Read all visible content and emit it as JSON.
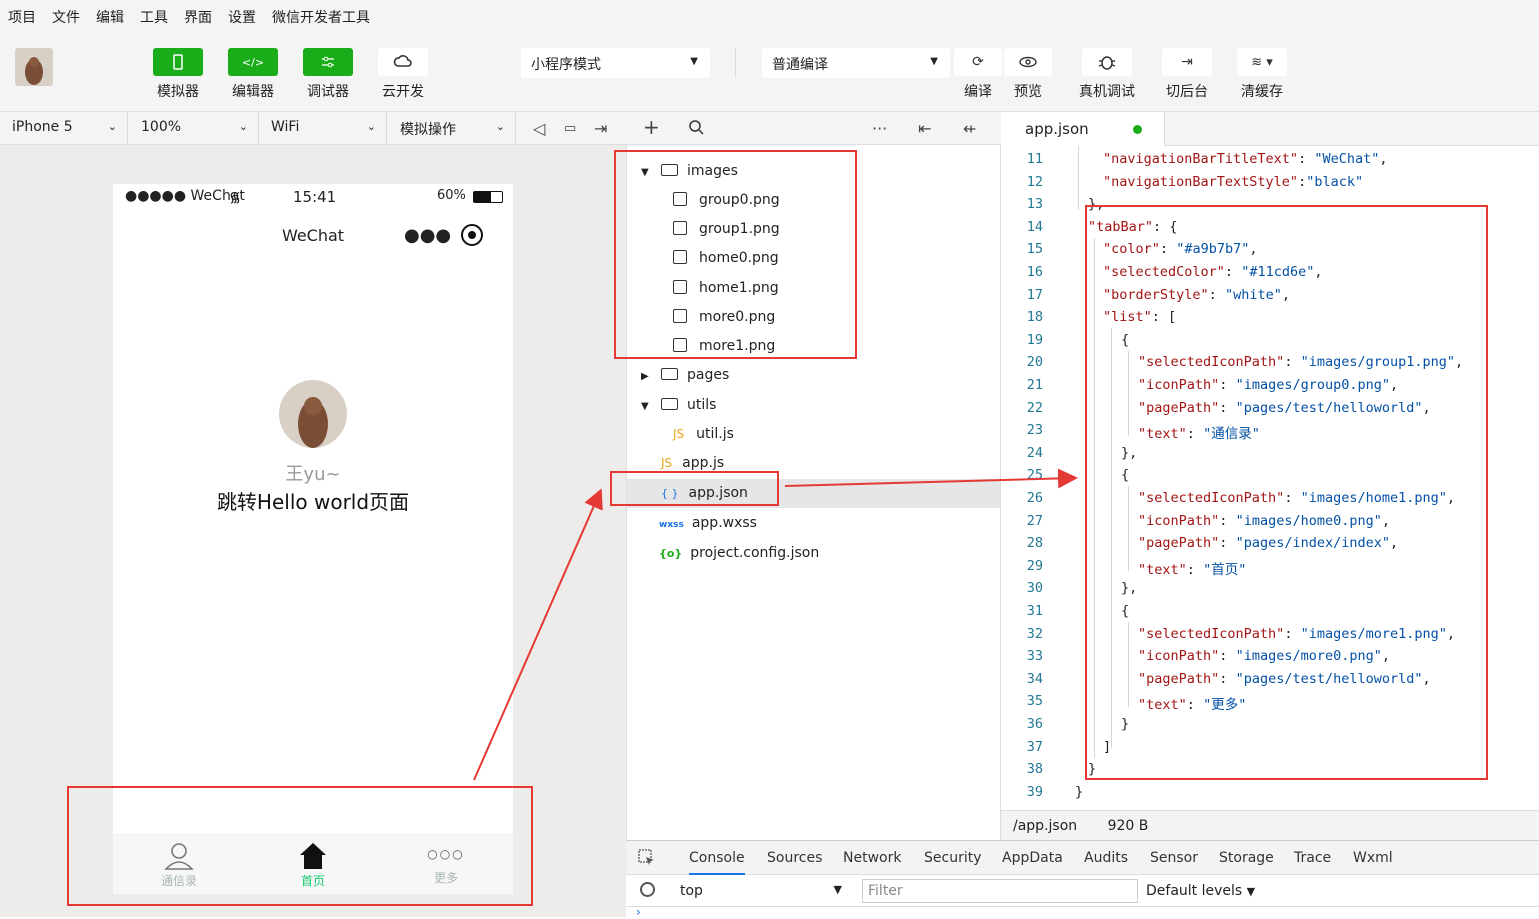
{
  "menu": [
    "项目",
    "文件",
    "编辑",
    "工具",
    "界面",
    "设置",
    "微信开发者工具"
  ],
  "toolbar": {
    "left_tools": [
      {
        "label": "模拟器",
        "icon": "phone-icon"
      },
      {
        "label": "编辑器",
        "icon": "code-icon"
      },
      {
        "label": "调试器",
        "icon": "debug-sliders-icon"
      },
      {
        "label": "云开发",
        "icon": "cloud-icon"
      }
    ],
    "mode_select": "小程序模式",
    "compile_select": "普通编译",
    "right_tools": [
      {
        "label": "编译",
        "icon": "refresh-icon"
      },
      {
        "label": "预览",
        "icon": "eye-icon"
      },
      {
        "label": "真机调试",
        "icon": "bug-icon"
      },
      {
        "label": "切后台",
        "icon": "switch-background-icon"
      },
      {
        "label": "清缓存",
        "icon": "layers-icon"
      }
    ]
  },
  "subbar": {
    "device": "iPhone 5",
    "zoom": "100%",
    "network": "WiFi",
    "sim_op": "模拟操作"
  },
  "phone": {
    "carrier": "●●●●● WeChat",
    "time": "15:41",
    "battery": "60%",
    "title": "WeChat",
    "nickname": "王yu~",
    "hello_text": "跳转Hello world页面",
    "tabs": [
      {
        "label": "通信录",
        "color": "#a9b7b7"
      },
      {
        "label": "首页",
        "color": "#11cd6e"
      },
      {
        "label": "更多",
        "color": "#a9b7b7"
      }
    ]
  },
  "tree": {
    "items": [
      {
        "label": "images",
        "type": "folder-open"
      },
      {
        "label": "group0.png",
        "type": "image"
      },
      {
        "label": "group1.png",
        "type": "image"
      },
      {
        "label": "home0.png",
        "type": "image"
      },
      {
        "label": "home1.png",
        "type": "image"
      },
      {
        "label": "more0.png",
        "type": "image"
      },
      {
        "label": "more1.png",
        "type": "image"
      },
      {
        "label": "pages",
        "type": "folder-closed"
      },
      {
        "label": "utils",
        "type": "folder-open"
      },
      {
        "label": "util.js",
        "type": "js",
        "badge": "JS"
      },
      {
        "label": "app.js",
        "type": "js",
        "badge": "JS"
      },
      {
        "label": "app.json",
        "type": "json",
        "badge": "{ }"
      },
      {
        "label": "app.wxss",
        "type": "wxss",
        "badge": "wxss"
      },
      {
        "label": "project.config.json",
        "type": "config",
        "badge": "{o}"
      }
    ]
  },
  "editor": {
    "tab_label": "app.json",
    "lines": [
      {
        "n": "11",
        "t": "\"navigationBarTitleText\": \"WeChat\","
      },
      {
        "n": "12",
        "t": "\"navigationBarTextStyle\":\"black\""
      },
      {
        "n": "13",
        "t": "},"
      },
      {
        "n": "14",
        "t": "\"tabBar\": {"
      },
      {
        "n": "15",
        "t": "\"color\": \"#a9b7b7\","
      },
      {
        "n": "16",
        "t": "\"selectedColor\": \"#11cd6e\","
      },
      {
        "n": "17",
        "t": "\"borderStyle\": \"white\","
      },
      {
        "n": "18",
        "t": "\"list\": ["
      },
      {
        "n": "19",
        "t": "{"
      },
      {
        "n": "20",
        "t": "\"selectedIconPath\": \"images/group1.png\","
      },
      {
        "n": "21",
        "t": "\"iconPath\": \"images/group0.png\","
      },
      {
        "n": "22",
        "t": "\"pagePath\": \"pages/test/helloworld\","
      },
      {
        "n": "23",
        "t": "\"text\": \"通信录\""
      },
      {
        "n": "24",
        "t": "},"
      },
      {
        "n": "25",
        "t": "{"
      },
      {
        "n": "26",
        "t": "\"selectedIconPath\": \"images/home1.png\","
      },
      {
        "n": "27",
        "t": "\"iconPath\": \"images/home0.png\","
      },
      {
        "n": "28",
        "t": "\"pagePath\": \"pages/index/index\","
      },
      {
        "n": "29",
        "t": "\"text\": \"首页\""
      },
      {
        "n": "30",
        "t": "},"
      },
      {
        "n": "31",
        "t": "{"
      },
      {
        "n": "32",
        "t": "\"selectedIconPath\": \"images/more1.png\","
      },
      {
        "n": "33",
        "t": "\"iconPath\": \"images/more0.png\","
      },
      {
        "n": "34",
        "t": "\"pagePath\": \"pages/test/helloworld\","
      },
      {
        "n": "35",
        "t": "\"text\": \"更多\""
      },
      {
        "n": "36",
        "t": "}"
      },
      {
        "n": "37",
        "t": "]"
      },
      {
        "n": "38",
        "t": "}"
      },
      {
        "n": "39",
        "t": "}"
      }
    ],
    "status_path": "/app.json",
    "status_size": "920 B"
  },
  "console": {
    "tabs": [
      "Console",
      "Sources",
      "Network",
      "Security",
      "AppData",
      "Audits",
      "Sensor",
      "Storage",
      "Trace",
      "Wxml"
    ],
    "context": "top",
    "filter_placeholder": "Filter",
    "levels": "Default levels"
  },
  "colors": {
    "accent_green": "#1aad19",
    "annotation_red": "#e53935"
  }
}
